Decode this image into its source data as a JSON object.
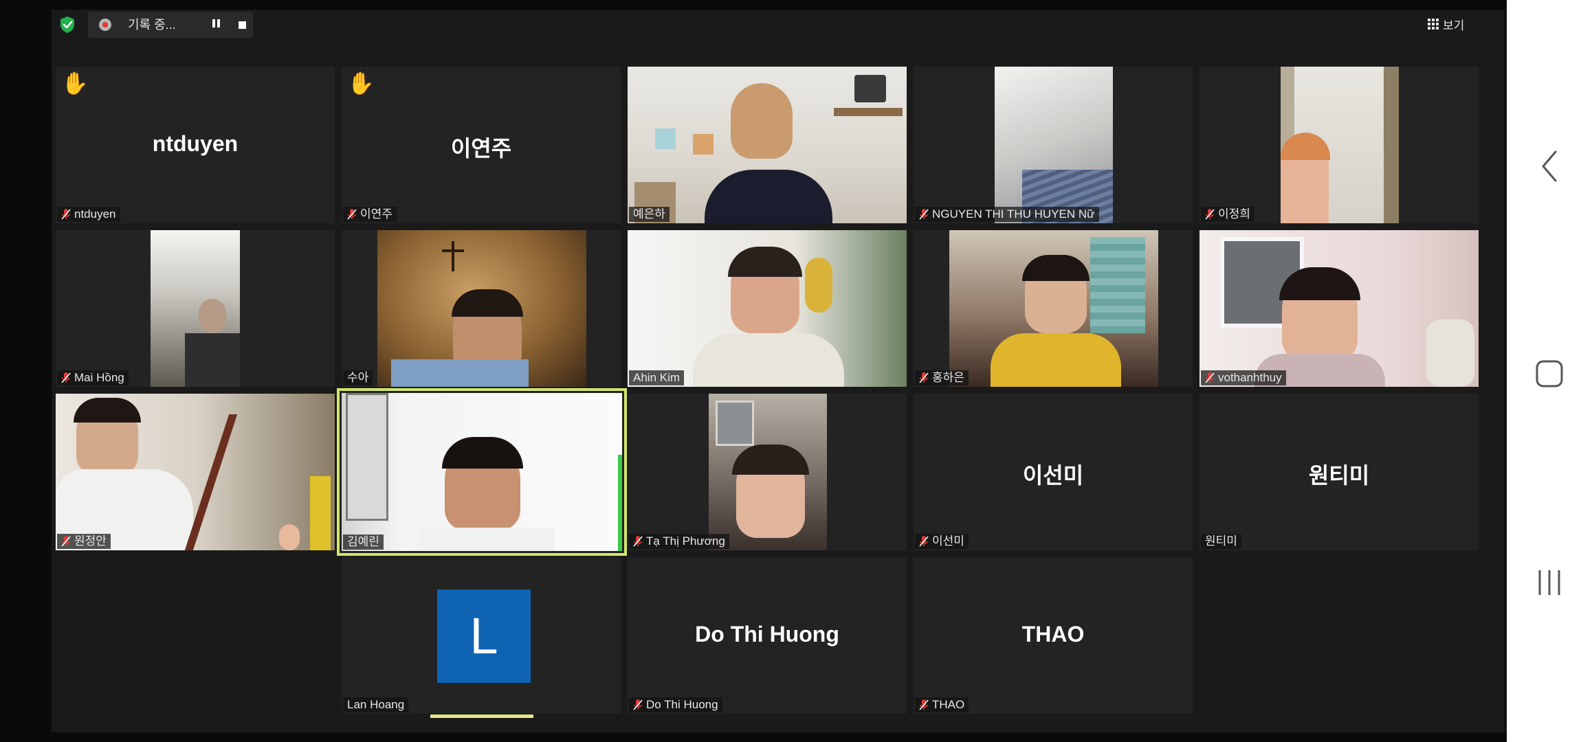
{
  "toolbar": {
    "recording_text": "기록 중...",
    "view_label": "보기",
    "icons": {
      "security": "shield-check-icon",
      "recording": "record-dot-icon",
      "pause": "pause-icon",
      "stop": "stop-icon",
      "view": "grid-icon"
    }
  },
  "participants": [
    {
      "id": "ntduyen",
      "name": "ntduyen",
      "display": "ntduyen",
      "muted": true,
      "hand": true,
      "video": false
    },
    {
      "id": "leeyeonju",
      "name": "이연주",
      "display": "이연주",
      "muted": true,
      "hand": true,
      "video": false
    },
    {
      "id": "yeeunha",
      "name": "예은하",
      "muted": false,
      "video": true
    },
    {
      "id": "nguyen-thi-thu-huyen",
      "name": "NGUYEN THI THU HUYEN Nữ",
      "muted": true,
      "video": true
    },
    {
      "id": "leejeonghui",
      "name": "이정희",
      "muted": true,
      "video": true
    },
    {
      "id": "mai-hong",
      "name": "Mai Hồng",
      "muted": true,
      "video": true
    },
    {
      "id": "sua",
      "name": "수아",
      "muted": false,
      "video": true
    },
    {
      "id": "ahin-kim",
      "name": "Ahin Kim",
      "muted": false,
      "video": true
    },
    {
      "id": "honghaeun",
      "name": "홍하은",
      "muted": true,
      "video": true
    },
    {
      "id": "vothanhthuy",
      "name": "vothanhthuy",
      "muted": true,
      "video": true
    },
    {
      "id": "wonjeongan",
      "name": "원정안",
      "muted": true,
      "video": true
    },
    {
      "id": "kimyerin",
      "name": "김예린",
      "muted": false,
      "video": true,
      "active_speaker": true
    },
    {
      "id": "ta-thi-phuong",
      "name": "Tạ Thị Phương",
      "muted": true,
      "video": true
    },
    {
      "id": "leeseonmi",
      "name": "이선미",
      "display": "이선미",
      "muted": true,
      "video": false
    },
    {
      "id": "wontimi",
      "name": "원티미",
      "display": "원티미",
      "muted": false,
      "video": false
    },
    {
      "id": "lan-hoang",
      "name": "Lan Hoang",
      "avatar_letter": "L",
      "muted": false,
      "video": false
    },
    {
      "id": "do-thi-huong",
      "name": "Do Thi Huong",
      "display": "Do Thi Huong",
      "muted": true,
      "video": false
    },
    {
      "id": "thao",
      "name": "THAO",
      "display": "THAO",
      "muted": true,
      "video": false
    }
  ],
  "colors": {
    "window_bg": "#1a1a1a",
    "tile_bg": "#232323",
    "active_speaker_border": "#d4e76b",
    "mute_icon": "#e53935",
    "avatar_bg": "#0e63b3",
    "nav_bg": "#ffffff"
  },
  "android_nav": {
    "icons": [
      "back-icon",
      "home-icon",
      "recents-icon"
    ]
  }
}
